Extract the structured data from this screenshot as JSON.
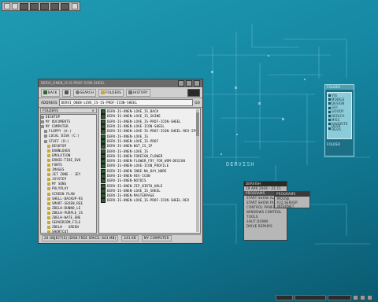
{
  "topbar": {
    "label": ""
  },
  "desktop": {
    "deco_text": "DERVISH"
  },
  "explorer": {
    "title": "DERVI_ONEN_IS-IS-PROF-ICON-SHEEL",
    "toolbar": {
      "back": "BACK",
      "up": "",
      "search": "SEARCH",
      "folders": "FOLDERS",
      "history": "HISTORY"
    },
    "address": {
      "label": "ADDRESS",
      "value": "DERVI_ONEN-LOVE_IS-IS-PROF-ICON-SHEEL",
      "go": "GO"
    },
    "folders_header": "FOLDERS",
    "tree": [
      "DESKTOP",
      "MY DOCUMENTS",
      "MY COMPUTER",
      "FLOPPY (A:)",
      "LOCAL DISK (C:)",
      "STUFF (D:)",
      "DESKTOP",
      "DOWNLOADS",
      "EMULATION",
      "ERNIE-TIDE_EVO",
      "FONTS",
      "IMAGES",
      "JET ZONE - JEY",
      "JOYSTEP",
      "MY SONG",
      "POLYPLAY",
      "SCREEN PLAN",
      "SHELL-BACKUP-RS",
      "SMART-SEVEN_REE",
      "ZBELH-DUNNO_LE",
      "ZBELH-PURPLE_IS",
      "ZBELH-WATE_ENE",
      "SERVERIBM_FILE",
      "ZBELH - GREEN",
      "SHORTCUT",
      "TEMP"
    ],
    "files": [
      "DERV-IS-ONEN-LOVE_IS_BACK",
      "DERV-IS-ONEN-LOVE_IS_SHINE",
      "DERV-IS-ONEN-LOVE_IS-PROF-ICON-SHEEL",
      "DERV-IS-ONEN-LOVE-ICON-SHEEL",
      "DERV-IS-ONEN-LOVE-IS-PROF-ICON-SHEEL-REV-IPS",
      "DERV-IS-ONEN-LOVE_IS",
      "DERV-IS-ONEN-LOVE_IS-PROF",
      "DERV-IS-ONEN-NOT_IS_IP",
      "DERV-IS-ONEN-LOVE_IS",
      "DERV-IS-ONEN-FOREIGN_FLOWER",
      "DERV-IS-ONEN-FLOWER_FRY_FOR_WOM-DESIGN",
      "DERV-IS-ONEN-LOVE-ICON_PROFILE",
      "DERV-IS-ONEN-INDE-NA_DAY_NORE",
      "DERV-IS-ONEN-REV-ICON",
      "DERV-IS-ONEN-NOTDIS",
      "DERV-IS-ONEN-ZIP_BIRTH_HOLE",
      "DERV-IS-ONEN-LOVE_IS_SHEEL",
      "DERV-IS-ONEN-MASTERPAGE",
      "DERV-IS-ONEN-LOVE_IS-PROF-ICON-SHEEL-REV"
    ],
    "status": {
      "objects": "20 OBJECT(S) (DISK FREE SPACE: 843 MB)",
      "size": "241 KB",
      "location": "MY COMPUTER"
    }
  },
  "right_panel": {
    "title": "FOLDER",
    "items": [
      "VIS",
      "MOBILE",
      "DESIGN",
      "GUI",
      "GOODY",
      "DEDICA",
      "MISC",
      "FAVORITE",
      "DESK DEVIL"
    ],
    "footer": "FOLDER"
  },
  "start_menu": {
    "header": "DERVISH",
    "subheader": "19 APR 2004 - 21:11",
    "section": "PROGRAMS",
    "items": [
      "START SHOW ALL",
      "START SHOW FAMS",
      "CONTROL PANEL",
      "WINDOWS CONTROL",
      "TOOLS",
      "SHUT DOWN",
      "DRIVE REPAIRS"
    ]
  },
  "submenu": {
    "header": "PROGRAMS",
    "items": [
      "MOUSE",
      "ICQ SERVER",
      "INTERNET"
    ]
  },
  "taskbar": {
    "label": "",
    "clock": ""
  },
  "colors": {
    "desktop": "#1688a3",
    "window": "#c9c9c9",
    "titlebar": "#6b6b6b"
  }
}
